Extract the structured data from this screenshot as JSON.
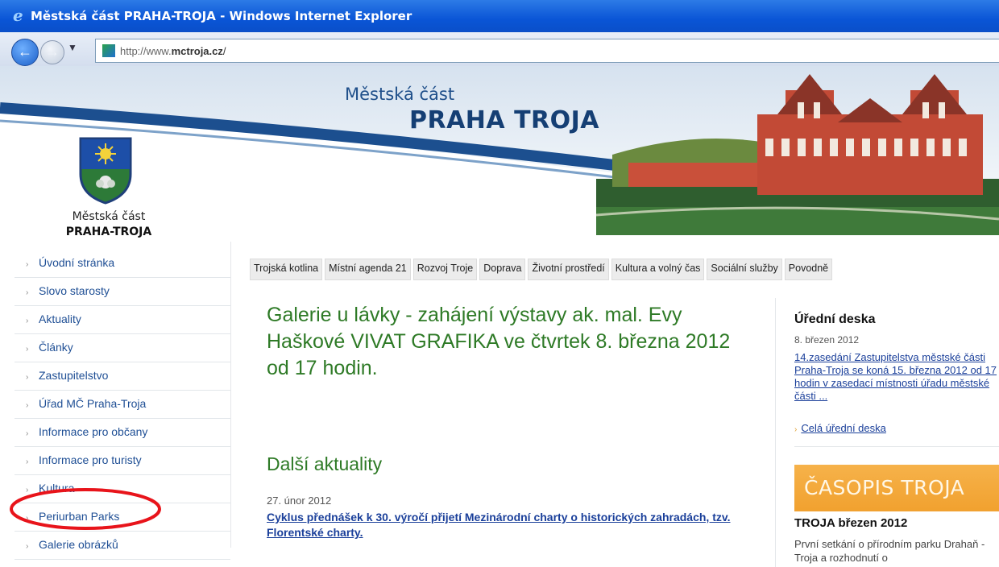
{
  "window": {
    "title": "Městská část PRAHA-TROJA - Windows Internet Explorer"
  },
  "addressbar": {
    "url_prefix": "http://www.",
    "url_domain": "mctroja.cz",
    "url_suffix": "/"
  },
  "header": {
    "brand_small": "Městská část",
    "brand_big": "PRAHA TROJA",
    "logo_line1": "Městská část",
    "logo_line2": "PRAHA-TROJA"
  },
  "sidebar": {
    "items": [
      {
        "label": "Úvodní stránka"
      },
      {
        "label": "Slovo starosty"
      },
      {
        "label": "Aktuality"
      },
      {
        "label": "Články"
      },
      {
        "label": "Zastupitelstvo"
      },
      {
        "label": "Úřad MČ Praha-Troja"
      },
      {
        "label": "Informace pro občany"
      },
      {
        "label": "Informace pro turisty"
      },
      {
        "label": "Kultura"
      },
      {
        "label": "Periurban Parks"
      },
      {
        "label": "Galerie obrázků"
      }
    ]
  },
  "tabs": [
    {
      "label": "Trojská kotlina"
    },
    {
      "label": "Místní agenda 21"
    },
    {
      "label": "Rozvoj Troje"
    },
    {
      "label": "Doprava"
    },
    {
      "label": "Životní prostředí"
    },
    {
      "label": "Kultura a volný čas"
    },
    {
      "label": "Sociální služby"
    },
    {
      "label": "Povodně"
    }
  ],
  "main": {
    "headline": "Galerie u lávky - zahájení výstavy ak. mal. Evy Haškové VIVAT GRAFIKA ve čtvrtek 8. března 2012 od 17 hodin.",
    "more_news_title": "Další aktuality",
    "news_date": "27. únor 2012",
    "news_link": "Cyklus přednášek k 30. výročí přijetí Mezinárodní charty o historických zahradách, tzv. Florentské charty."
  },
  "official_board": {
    "title": "Úřední deska",
    "date": "8. březen 2012",
    "link": "14.zasedání Zastupitelstva městské části Praha-Troja se koná 15. března 2012 od 17 hodin v zasedací místnosti úřadu městské části ...",
    "all_link": "Celá úřední deska"
  },
  "magazine": {
    "banner": "ČASOPIS TROJA",
    "issue_title": "TROJA březen 2012",
    "issue_text": "První setkání o přírodním parku Drahaň - Troja a rozhodnutí o"
  },
  "colors": {
    "titlebar": "#0a55d6",
    "headline_green": "#2e7a26",
    "link_blue": "#1a3f9a",
    "annotation_red": "#e8141b",
    "magazine_orange": "#f1a12f"
  }
}
